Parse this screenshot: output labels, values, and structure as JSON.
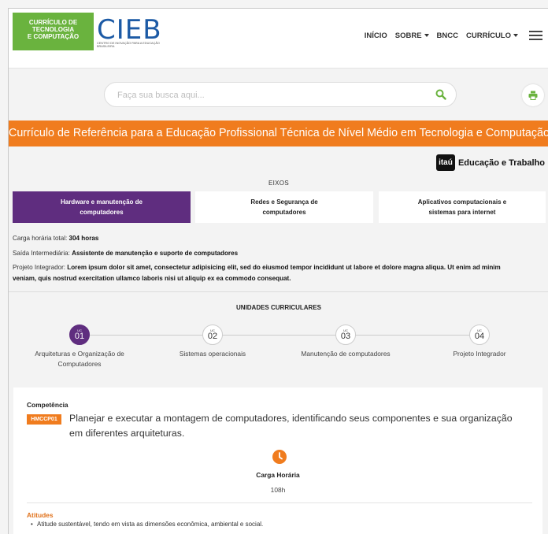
{
  "header": {
    "brand_box_lines": [
      "CURRÍCULO DE",
      "TECNOLOGIA",
      "E COMPUTAÇÃO"
    ],
    "logo_text": "CIEB",
    "logo_subtitle": "CENTRO DE INOVAÇÃO PARA A EDUCAÇÃO BRASILEIRA",
    "nav": [
      {
        "label": "INÍCIO",
        "dropdown": false
      },
      {
        "label": "SOBRE",
        "dropdown": true
      },
      {
        "label": "BNCC",
        "dropdown": false
      },
      {
        "label": "CURRÍCULO",
        "dropdown": true
      }
    ]
  },
  "search": {
    "placeholder": "Faça sua busca aqui..."
  },
  "banner": {
    "title": "Currículo de Referência para a Educação Profissional Técnica de Nível Médio em Tecnologia e Computação"
  },
  "partner": {
    "badge": "itaú",
    "text": "Educação e Trabalho"
  },
  "eixos": {
    "title": "EIXOS",
    "tabs": [
      {
        "label_1": "Hardware e manutenção de",
        "label_2": "computadores",
        "active": true
      },
      {
        "label_1": "Redes e Segurança de",
        "label_2": "computadores",
        "active": false
      },
      {
        "label_1": "Aplicativos computacionais e",
        "label_2": "sistemas para internet",
        "active": false
      }
    ]
  },
  "info": {
    "carga_label": "Carga horária total: ",
    "carga_value": "304 horas",
    "saida_label": "Saída Intermediária: ",
    "saida_value": "Assistente de manutenção e suporte de computadores",
    "projeto_label": "Projeto Integrador: ",
    "projeto_value_1": "Lorem ipsum dolor sit amet, consectetur adipisicing elit, sed do eiusmod tempor incididunt ut labore et dolore magna aliqua. Ut enim ad minim",
    "projeto_value_2": "veniam, quis nostrud exercitation ullamco laboris nisi ut aliquip ex ea commodo consequat."
  },
  "unidades": {
    "title": "UNIDADES CURRICULARES",
    "items": [
      {
        "small": "UC",
        "num": "01",
        "label_1": "Arquiteturas e Organização de",
        "label_2": "Computadores",
        "active": true
      },
      {
        "small": "UC",
        "num": "02",
        "label_1": "Sistemas operacionais",
        "label_2": "",
        "active": false
      },
      {
        "small": "UC",
        "num": "03",
        "label_1": "Manutenção de computadores",
        "label_2": "",
        "active": false
      },
      {
        "small": "UC",
        "num": "04",
        "label_1": "Projeto Integrador",
        "label_2": "",
        "active": false
      }
    ]
  },
  "competencia": {
    "label": "Competência",
    "code": "HMCCP01",
    "text": "Planejar e executar a montagem de computadores, identificando seus componentes e sua organização em diferentes arquiteturas.",
    "carga_label": "Carga Horária",
    "carga_value": "108h",
    "atitudes_label": "Atitudes",
    "atitudes": [
      "Atitude sustentável, tendo em vista as dimensões econômica, ambiental e social."
    ]
  },
  "colors": {
    "green": "#6ab33e",
    "blue": "#1c5aa5",
    "orange": "#f07c1e",
    "purple": "#5f2d7f"
  }
}
